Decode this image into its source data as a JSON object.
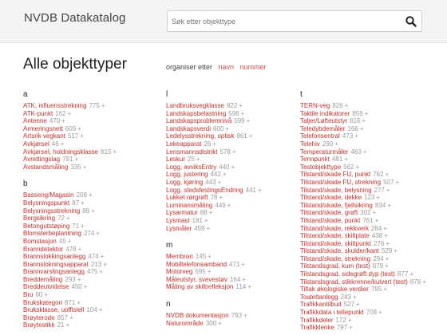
{
  "header": {
    "brand": "NVDB Datakatalog",
    "search_placeholder": "Søk etter objekttype"
  },
  "title": "Alle objekttyper",
  "organise": {
    "label": "organiser etter",
    "options": [
      "navn",
      "nummer"
    ]
  },
  "plus_symbol": "+",
  "columns": [
    [
      {
        "letter": "a",
        "items": [
          {
            "name": "ATK, influensstrekning",
            "count": "775"
          },
          {
            "name": "ATK-punkt",
            "count": "162"
          },
          {
            "name": "Antenne",
            "count": "470"
          },
          {
            "name": "Armeringsnett",
            "count": "609"
          },
          {
            "name": "Artsrik vegkant",
            "count": "517"
          },
          {
            "name": "Avkjørsel",
            "count": "46"
          },
          {
            "name": "Avkjørsel, holdningsklasse",
            "count": "815"
          },
          {
            "name": "Avrettingslag",
            "count": "791"
          },
          {
            "name": "Avstandsmåling",
            "count": "335"
          }
        ]
      },
      {
        "letter": "b",
        "items": [
          {
            "name": "Basseng/Magasin",
            "count": "208"
          },
          {
            "name": "Belysningspunkt",
            "count": "87"
          },
          {
            "name": "Belysningsstrekning",
            "count": "86"
          },
          {
            "name": "Bergsikring",
            "count": "72"
          },
          {
            "name": "Betongutstøping",
            "count": "71"
          },
          {
            "name": "Blomsterbeplantning",
            "count": "274"
          },
          {
            "name": "Bomstasjon",
            "count": "45"
          },
          {
            "name": "Branndetektor",
            "count": "478"
          },
          {
            "name": "Brannslokkingsanlegg",
            "count": "474"
          },
          {
            "name": "Brannslokningsapparat",
            "count": "213"
          },
          {
            "name": "Brannvarslingsanlegg",
            "count": "475"
          },
          {
            "name": "Breddemåling",
            "count": "293"
          },
          {
            "name": "Breddeutvidelse",
            "count": "450"
          },
          {
            "name": "Bru",
            "count": "60"
          },
          {
            "name": "Brukskategori",
            "count": "871"
          },
          {
            "name": "Bruksklasse, uoffisiell",
            "count": "104"
          },
          {
            "name": "Brøyterode",
            "count": "857"
          },
          {
            "name": "Brøytestikk",
            "count": "21"
          }
        ]
      }
    ],
    [
      {
        "letter": "l",
        "items": [
          {
            "name": "Landbruksvegklasse",
            "count": "822"
          },
          {
            "name": "Landskapsbelastning",
            "count": "598"
          },
          {
            "name": "Landskapsproblemnivå",
            "count": "599"
          },
          {
            "name": "Landskapsverdi",
            "count": "600"
          },
          {
            "name": "Ledelysstrekning, optisk",
            "count": "861"
          },
          {
            "name": "Lekeapparat",
            "count": "26"
          },
          {
            "name": "Lensmannsdistrikt",
            "count": "578"
          },
          {
            "name": "Leskur",
            "count": "25"
          },
          {
            "name": "Logg, avviksEntry",
            "count": "440"
          },
          {
            "name": "Logg, justering",
            "count": "442"
          },
          {
            "name": "Logg, kjøring",
            "count": "443"
          },
          {
            "name": "Logg, stedsfestingsEndring",
            "count": "441"
          },
          {
            "name": "Lukket rørgrøft",
            "count": "78"
          },
          {
            "name": "Luminansmåling",
            "count": "449"
          },
          {
            "name": "Lysarmatur",
            "count": "88"
          },
          {
            "name": "Lysmast",
            "count": "181"
          },
          {
            "name": "Lysmåler",
            "count": "459"
          }
        ]
      },
      {
        "letter": "m",
        "items": [
          {
            "name": "Membran",
            "count": "145"
          },
          {
            "name": "Mobiltelefonsamband",
            "count": "471"
          },
          {
            "name": "Motorveg",
            "count": "595"
          },
          {
            "name": "Måleutstyr, svevestøv",
            "count": "164"
          },
          {
            "name": "Måling av skiltrefleksjon",
            "count": "114"
          }
        ]
      },
      {
        "letter": "n",
        "items": [
          {
            "name": "NVDB dokumentasjon",
            "count": "793"
          },
          {
            "name": "Naturområde",
            "count": "300"
          }
        ]
      }
    ],
    [
      {
        "letter": "t",
        "items": [
          {
            "name": "TERN-veg",
            "count": "826"
          },
          {
            "name": "Taktile indikatorer",
            "count": "859"
          },
          {
            "name": "Taljer/Løfteutstyr",
            "count": "816"
          },
          {
            "name": "Teledybdemåler",
            "count": "166"
          },
          {
            "name": "Telefonsentral",
            "count": "473"
          },
          {
            "name": "Telehiv",
            "count": "290"
          },
          {
            "name": "Temperaturmåler",
            "count": "463"
          },
          {
            "name": "Tennpunkt",
            "count": "481"
          },
          {
            "name": "Testobjekttype",
            "count": "562"
          },
          {
            "name": "Tilstand/skade FU, punkt",
            "count": "762"
          },
          {
            "name": "Tilstand/skade FU, strekning",
            "count": "507"
          },
          {
            "name": "Tilstand/skade, belysning",
            "count": "277"
          },
          {
            "name": "Tilstand/skade, dekke",
            "count": "123"
          },
          {
            "name": "Tilstand/skade, fjellsikring",
            "count": "834"
          },
          {
            "name": "Tilstand/skade, grøft",
            "count": "302"
          },
          {
            "name": "Tilstand/skade, punkt",
            "count": "761"
          },
          {
            "name": "Tilstand/skade, rekkverk",
            "count": "284"
          },
          {
            "name": "Tilstand/skade, skiltplate",
            "count": "438"
          },
          {
            "name": "Tilstand/skade, skiltpunkt",
            "count": "276"
          },
          {
            "name": "Tilstand/skade, skulder/kant",
            "count": "529"
          },
          {
            "name": "Tilstand/skade, strekning",
            "count": "294"
          },
          {
            "name": "Tilstandsgrad, kum (test)",
            "count": "879"
          },
          {
            "name": "Tilstandsgrad, sidegrøft dyp (test)",
            "count": "877"
          },
          {
            "name": "Tilstandsgrad, stikkrenne/kulvert (test)",
            "count": "878"
          },
          {
            "name": "Tiltak økologiske verdier",
            "count": "795"
          },
          {
            "name": "Toalettanlegg",
            "count": "243"
          },
          {
            "name": "Trafikkantilbud",
            "count": "527"
          },
          {
            "name": "Trafikkdata i tellepunkt",
            "count": "708"
          },
          {
            "name": "Trafikkdeler",
            "count": "172"
          },
          {
            "name": "Trafikklenke",
            "count": "797"
          }
        ]
      }
    ]
  ],
  "colors": {
    "link": "#c9302c",
    "count": "#9a9a9a",
    "header_bg": "#f4f4f4"
  },
  "icons": {
    "search": "search-icon"
  }
}
